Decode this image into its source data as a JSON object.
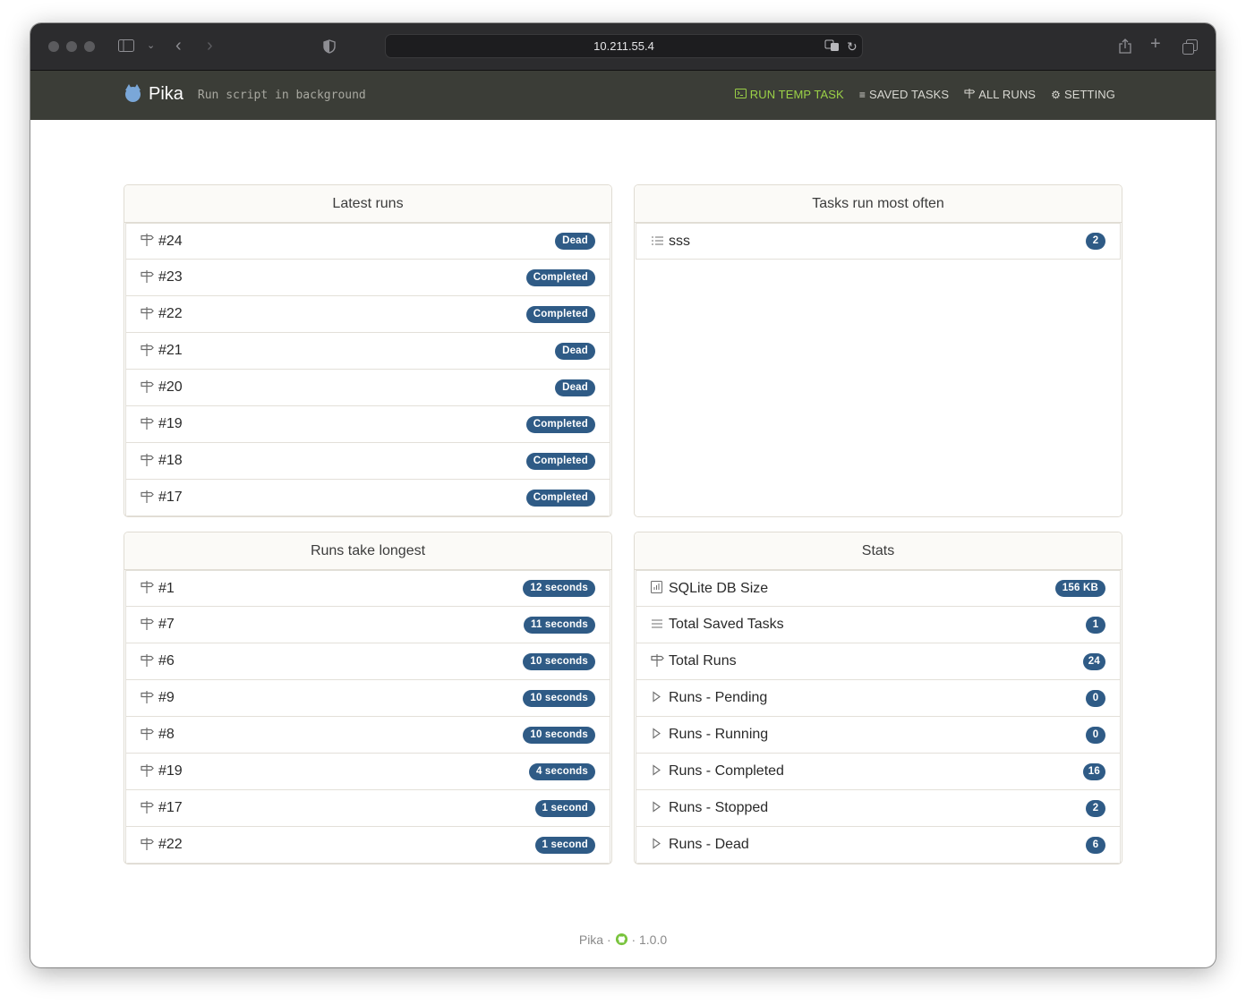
{
  "browser": {
    "url": "10.211.55.4"
  },
  "navbar": {
    "brand": "Pika",
    "tagline": "Run script in background",
    "links": [
      {
        "label": "RUN TEMP TASK",
        "icon": "terminal-icon"
      },
      {
        "label": "SAVED TASKS",
        "icon": "list-icon"
      },
      {
        "label": "ALL RUNS",
        "icon": "signpost-icon"
      },
      {
        "label": "SETTING",
        "icon": "gear-icon"
      }
    ]
  },
  "latest_runs": {
    "title": "Latest runs",
    "items": [
      {
        "label": "#24",
        "badge": "Dead"
      },
      {
        "label": "#23",
        "badge": "Completed"
      },
      {
        "label": "#22",
        "badge": "Completed"
      },
      {
        "label": "#21",
        "badge": "Dead"
      },
      {
        "label": "#20",
        "badge": "Dead"
      },
      {
        "label": "#19",
        "badge": "Completed"
      },
      {
        "label": "#18",
        "badge": "Completed"
      },
      {
        "label": "#17",
        "badge": "Completed"
      }
    ]
  },
  "tasks_often": {
    "title": "Tasks run most often",
    "items": [
      {
        "label": "sss",
        "badge": "2"
      }
    ]
  },
  "runs_longest": {
    "title": "Runs take longest",
    "items": [
      {
        "label": "#1",
        "badge": "12 seconds"
      },
      {
        "label": "#7",
        "badge": "11 seconds"
      },
      {
        "label": "#6",
        "badge": "10 seconds"
      },
      {
        "label": "#9",
        "badge": "10 seconds"
      },
      {
        "label": "#8",
        "badge": "10 seconds"
      },
      {
        "label": "#19",
        "badge": "4 seconds"
      },
      {
        "label": "#17",
        "badge": "1 second"
      },
      {
        "label": "#22",
        "badge": "1 second"
      }
    ]
  },
  "stats": {
    "title": "Stats",
    "items": [
      {
        "label": "SQLite DB Size",
        "badge": "156 KB",
        "icon": "chart-icon"
      },
      {
        "label": "Total Saved Tasks",
        "badge": "1",
        "icon": "list-icon"
      },
      {
        "label": "Total Runs",
        "badge": "24",
        "icon": "signpost-icon"
      },
      {
        "label": "Runs - Pending",
        "badge": "0",
        "icon": "play-icon"
      },
      {
        "label": "Runs - Running",
        "badge": "0",
        "icon": "play-icon"
      },
      {
        "label": "Runs - Completed",
        "badge": "16",
        "icon": "play-icon"
      },
      {
        "label": "Runs - Stopped",
        "badge": "2",
        "icon": "play-icon"
      },
      {
        "label": "Runs - Dead",
        "badge": "6",
        "icon": "play-icon"
      }
    ]
  },
  "footer": {
    "name": "Pika",
    "separator": "·",
    "version": "1.0.0"
  },
  "colors": {
    "badge": "#2f5b86",
    "navbar": "#3b3d37",
    "active_link": "#9bd147"
  }
}
